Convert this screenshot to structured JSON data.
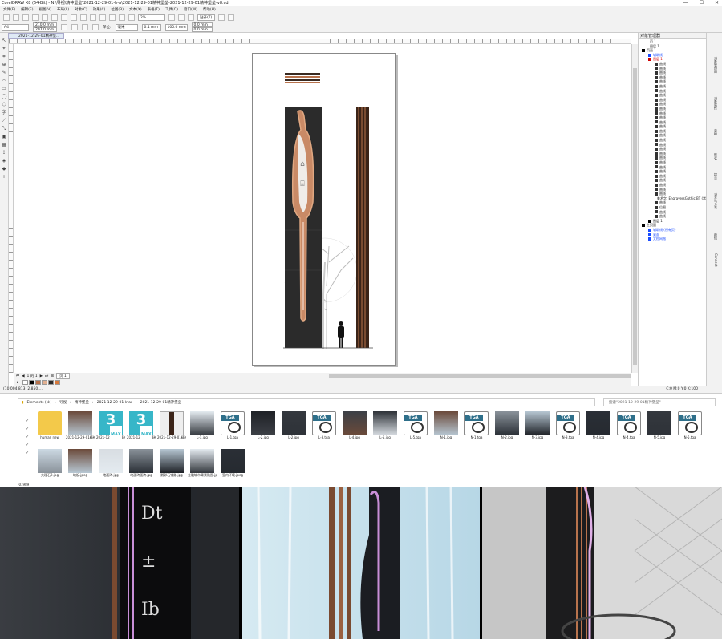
{
  "app": {
    "window_title": "CorelDRAW X8 (64-Bit) - N:\\导视\\精神堡垒\\2021-12-29-01-lr-a\\2021-12-29-01精神堡垒-2021-12-29-01精神堡垒-v8.cdr",
    "controls": [
      "—",
      "☐",
      "✕"
    ]
  },
  "menu": {
    "items": [
      "文件(F)",
      "编辑(E)",
      "视图(V)",
      "布局(L)",
      "对象(C)",
      "效果(C)",
      "位图(B)",
      "文本(X)",
      "表格(T)",
      "工具(O)",
      "窗口(W)",
      "帮助(H)"
    ]
  },
  "toolbar": {
    "zoom": "2%",
    "snap": "贴齐(T)"
  },
  "propbar": {
    "page_size": "A4",
    "width": "210.0 mm",
    "height": "297.0 mm",
    "units_label": "单位:",
    "units": "毫米",
    "nudge": "0.1 mm",
    "nudge2": "100.0 mm",
    "dup_x": "0.0 mm",
    "dup_y": "0.0 mm"
  },
  "document": {
    "tab": "2021-12-29-01精神堡..."
  },
  "pagenav": {
    "label": "1 的 1",
    "page": "页 1"
  },
  "status": {
    "coords": "(10,004.813, 2,850....",
    "fill": "C:0 M:0 Y:0 K:100"
  },
  "objmgr": {
    "title": "对象管理器",
    "page": "页 1",
    "layer": "图层 1",
    "rows": [
      {
        "label": "页面 1",
        "color": "#000000",
        "indent": 0
      },
      {
        "label": "辅助线",
        "color": "#1a4cff",
        "indent": 1
      },
      {
        "label": "图层 1",
        "color": "#d00000",
        "indent": 1
      },
      {
        "label": "曲线",
        "color": "#333333",
        "indent": 2
      },
      {
        "label": "曲线",
        "color": "#333333",
        "indent": 2
      },
      {
        "label": "曲线",
        "color": "#333333",
        "indent": 2
      },
      {
        "label": "曲线",
        "color": "#333333",
        "indent": 2
      },
      {
        "label": "曲线",
        "color": "#333333",
        "indent": 2
      },
      {
        "label": "曲线",
        "color": "#333333",
        "indent": 2
      },
      {
        "label": "曲线",
        "color": "#333333",
        "indent": 2
      },
      {
        "label": "曲线",
        "color": "#333333",
        "indent": 2
      },
      {
        "label": "曲线",
        "color": "#333333",
        "indent": 2
      },
      {
        "label": "曲线",
        "color": "#333333",
        "indent": 2
      },
      {
        "label": "曲线",
        "color": "#333333",
        "indent": 2
      },
      {
        "label": "曲线",
        "color": "#333333",
        "indent": 2
      },
      {
        "label": "曲线",
        "color": "#333333",
        "indent": 2
      },
      {
        "label": "曲线",
        "color": "#333333",
        "indent": 2
      },
      {
        "label": "曲线",
        "color": "#333333",
        "indent": 2
      },
      {
        "label": "曲线",
        "color": "#333333",
        "indent": 2
      },
      {
        "label": "曲线",
        "color": "#333333",
        "indent": 2
      },
      {
        "label": "曲线",
        "color": "#333333",
        "indent": 2
      },
      {
        "label": "曲线",
        "color": "#333333",
        "indent": 2
      },
      {
        "label": "曲线",
        "color": "#333333",
        "indent": 2
      },
      {
        "label": "曲线",
        "color": "#333333",
        "indent": 2
      },
      {
        "label": "曲线",
        "color": "#333333",
        "indent": 2
      },
      {
        "label": "曲线",
        "color": "#333333",
        "indent": 2
      },
      {
        "label": "曲线",
        "color": "#333333",
        "indent": 2
      },
      {
        "label": "曲线",
        "color": "#333333",
        "indent": 2
      },
      {
        "label": "曲线",
        "color": "#333333",
        "indent": 2
      },
      {
        "label": "曲线",
        "color": "#333333",
        "indent": 2
      },
      {
        "label": "曲线",
        "color": "#333333",
        "indent": 2
      },
      {
        "label": "曲线",
        "color": "#333333",
        "indent": 2
      },
      {
        "label": "曲线",
        "color": "#333333",
        "indent": 2
      },
      {
        "label": "美术字: EngraversGothic BT (常",
        "color": "#333333",
        "indent": 2
      },
      {
        "label": "曲线",
        "color": "#333333",
        "indent": 2
      },
      {
        "label": "位图",
        "color": "#333333",
        "indent": 2
      },
      {
        "label": "曲线",
        "color": "#333333",
        "indent": 2
      },
      {
        "label": "曲线",
        "color": "#333333",
        "indent": 2
      },
      {
        "label": "图层 1",
        "color": "#000000",
        "indent": 1
      },
      {
        "label": "主页面",
        "color": "#000000",
        "indent": 0
      },
      {
        "label": "辅助线 (所有页)",
        "color": "#1a4cff",
        "indent": 1
      },
      {
        "label": "桌面",
        "color": "#1a4cff",
        "indent": 1
      },
      {
        "label": "文档网格",
        "color": "#1a4cff",
        "indent": 1
      }
    ]
  },
  "docker_tabs": [
    "对象管理器",
    "对象属性",
    "变换",
    "形状",
    "提示",
    "对齐与分布",
    "颜色",
    "Connect"
  ],
  "explorer": {
    "path": [
      "Elements (N:)",
      "导视",
      "精神堡垒",
      "2021-12-29-01-lr-ar",
      "2021-12-29-01精神堡垒"
    ],
    "search_placeholder": "搜索\"2021-12-29-01精神堡垒\"",
    "count": "-01989",
    "row1": [
      {
        "name": "human new",
        "type": "folder"
      },
      {
        "name": "2021-12-29-01精神堡垒.jpg",
        "type": "img"
      },
      {
        "name": "2021-12-29-01精神堡垒-1.max",
        "type": "max"
      },
      {
        "name": "2021-12-29-01精神堡垒-N.max",
        "type": "max"
      },
      {
        "name": "2021-12-29-01精神堡垒-v8.cdr",
        "type": "cdr"
      },
      {
        "name": "L-1.jpg",
        "type": "img"
      },
      {
        "name": "L-1.tga",
        "type": "tga"
      },
      {
        "name": "L-2.jpg",
        "type": "img"
      },
      {
        "name": "L-2.jpg",
        "type": "img"
      },
      {
        "name": "L-3.tga",
        "type": "tga"
      },
      {
        "name": "L-4.jpg",
        "type": "img"
      },
      {
        "name": "L-5.jpg",
        "type": "img"
      },
      {
        "name": "L-5.tga",
        "type": "tga"
      },
      {
        "name": "N-1.jpg",
        "type": "img"
      },
      {
        "name": "N-1.tga",
        "type": "tga"
      },
      {
        "name": "N-2.jpg",
        "type": "img"
      },
      {
        "name": "N-3.jpg",
        "type": "img"
      },
      {
        "name": "N-3.tga",
        "type": "tga"
      },
      {
        "name": "N-4.jpg",
        "type": "img"
      },
      {
        "name": "N-4.tga",
        "type": "tga"
      },
      {
        "name": "N-5.jpg",
        "type": "img"
      },
      {
        "name": "N-5.tga",
        "type": "tga"
      }
    ],
    "row2": [
      {
        "name": "大理石2.jpg",
        "type": "img"
      },
      {
        "name": "地板.jpeg",
        "type": "img"
      },
      {
        "name": "地面砖.jpg",
        "type": "img"
      },
      {
        "name": "地面砖面砖.jpg",
        "type": "img"
      },
      {
        "name": "鹅卵石铺路.jpg",
        "type": "img"
      },
      {
        "name": "金融城市背景贴图.jpeg",
        "type": "img"
      },
      {
        "name": "室内环境.jpeg",
        "type": "img"
      }
    ]
  },
  "colors": {
    "chrome": "#f2f2f2",
    "accent_blue": "#1a4cff",
    "pylon_dark": "#2b2b2b",
    "copper": "#b8734d"
  }
}
